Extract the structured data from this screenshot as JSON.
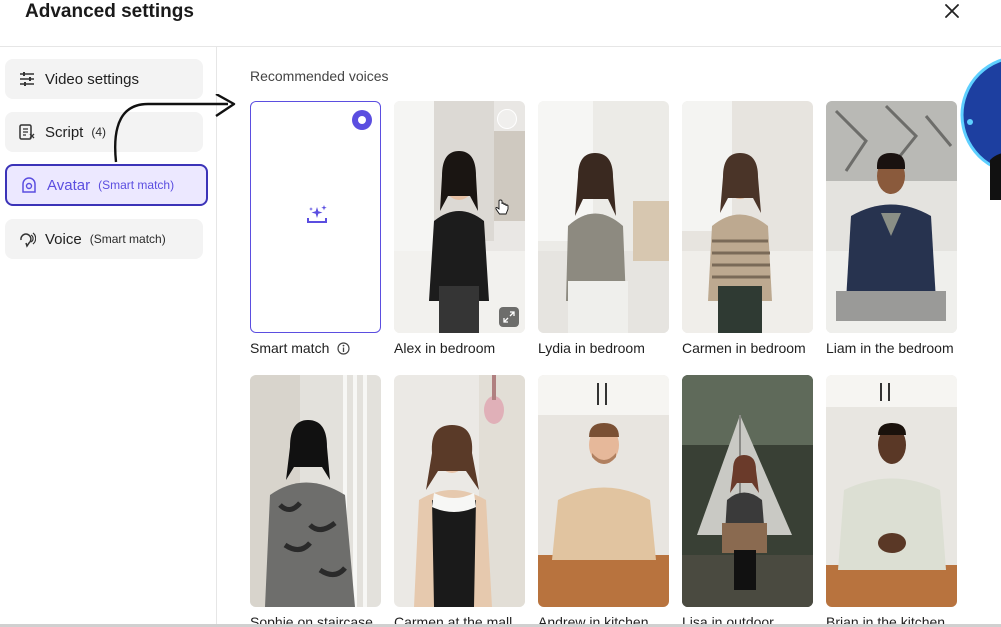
{
  "header": {
    "title": "Advanced settings"
  },
  "sidebar": {
    "items": [
      {
        "label": "Video settings",
        "sub": "",
        "icon": "sliders-icon"
      },
      {
        "label": "Script",
        "sub": "(4)",
        "icon": "script-icon"
      },
      {
        "label": "Avatar",
        "sub": "(Smart match)",
        "icon": "avatar-icon",
        "active": true
      },
      {
        "label": "Voice",
        "sub": "(Smart match)",
        "icon": "voice-icon"
      }
    ]
  },
  "main": {
    "section_title": "Recommended voices",
    "cards": [
      {
        "label": "Smart match",
        "selected": true
      },
      {
        "label": "Alex in bedroom"
      },
      {
        "label": "Lydia in bedroom"
      },
      {
        "label": "Carmen in bedroom"
      },
      {
        "label": "Liam in the bedroom"
      },
      {
        "label": "Sophie on staircase"
      },
      {
        "label": "Carmen at the mall"
      },
      {
        "label": "Andrew in kitchen"
      },
      {
        "label": "Lisa in outdoor"
      },
      {
        "label": "Brian in the kitchen"
      }
    ]
  },
  "colors": {
    "accent": "#5b4ee0",
    "active_border": "#3b33b8",
    "active_bg": "#ece8ff"
  }
}
